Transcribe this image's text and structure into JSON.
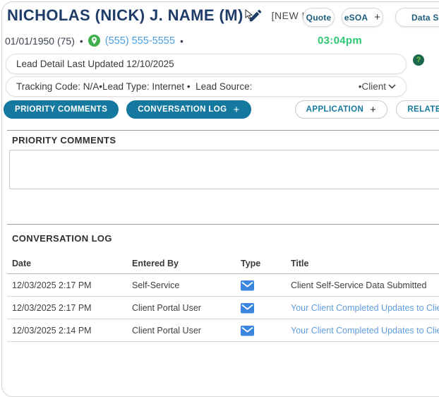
{
  "colors": {
    "accent_teal": "#15789E",
    "title_navy": "#1F3D68",
    "phone_blue": "#4A9EE2",
    "table_link_blue": "#5F9EDC",
    "time_green": "#2EC873",
    "pin_green": "#3FAE4C",
    "help_green": "#19684F",
    "envelope_blue": "#3C86DF"
  },
  "header": {
    "title": "NICHOLAS (NICK) J. NAME (M)",
    "badge": "[NEW LEAD]",
    "buttons": {
      "quote": "Quote",
      "esoa": "eSOA",
      "esoa_plus": "+",
      "data": "Data S"
    }
  },
  "info": {
    "dob": "01/01/1950 (75)",
    "separator": "•",
    "phone": "(555) 555-5555",
    "time": "03:04pm"
  },
  "lead_detail_bar": {
    "text": "Lead Detail Last Updated 12/10/2025",
    "help_glyph": "?"
  },
  "tracking_bar": {
    "text": "Tracking Code: N/A•Lead Type: Internet •  Lead Source:",
    "dropdown_value": "•Client"
  },
  "tabs": [
    {
      "label": "PRIORITY COMMENTS",
      "plus": "",
      "style": "filled"
    },
    {
      "label": "CONVERSATION LOG",
      "plus": "+",
      "style": "filled"
    },
    {
      "label": "APPLICATION",
      "plus": "+",
      "style": "outline"
    },
    {
      "label": "RELATED",
      "plus": "+",
      "style": "outline"
    }
  ],
  "priority_comments": {
    "heading": "PRIORITY COMMENTS",
    "value": ""
  },
  "conversation_log": {
    "heading": "CONVERSATION LOG",
    "columns": [
      "Date",
      "Entered By",
      "Type",
      "Title"
    ],
    "rows": [
      {
        "date": "12/03/2025 2:17 PM",
        "entered_by": "Self-Service",
        "type": "email",
        "title": "Client Self-Service Data Submitted",
        "is_link": false
      },
      {
        "date": "12/03/2025 2:17 PM",
        "entered_by": "Client Portal User",
        "type": "email",
        "title": "Your Client Completed Updates to Client",
        "is_link": true
      },
      {
        "date": "12/03/2025 2:14 PM",
        "entered_by": "Client Portal User",
        "type": "email",
        "title": "Your Client Completed Updates to Client",
        "is_link": true
      }
    ]
  }
}
